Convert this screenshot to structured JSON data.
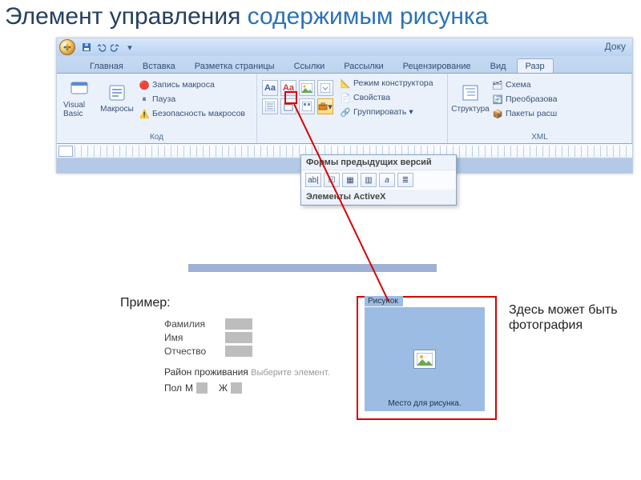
{
  "slide": {
    "title_plain": "Элемент управления ",
    "title_blue": "содержимым рисунка"
  },
  "window": {
    "doc_title": "Доку"
  },
  "tabs": {
    "home": "Главная",
    "insert": "Вставка",
    "layout": "Разметка страницы",
    "refs": "Ссылки",
    "mail": "Рассылки",
    "review": "Рецензирование",
    "view": "Вид",
    "dev": "Разр"
  },
  "ribbon": {
    "code": {
      "vb": "Visual Basic",
      "macros": "Макросы",
      "record": "Запись макроса",
      "pause": "Пауза",
      "security": "Безопасность макросов",
      "group": "Код"
    },
    "controls": {
      "aa1": "Aa",
      "aa2": "Aa",
      "design": "Режим конструктора",
      "props": "Свойства",
      "group": "Группировать"
    },
    "structure": {
      "btn": "Структура",
      "schema": "Схема",
      "transform": "Преобразова",
      "packs": "Пакеты расш",
      "group": "XML"
    }
  },
  "popup": {
    "sec1": "Формы предыдущих версий",
    "btns": [
      "ab|",
      "☑",
      "▦",
      "▥",
      "a",
      "≣"
    ],
    "sec2": "Элементы ActiveX"
  },
  "example": {
    "title": "Пример:",
    "fields": {
      "surname": "Фамилия",
      "name": "Имя",
      "patronymic": "Отчество"
    },
    "district_lbl": "Район проживания",
    "district_hint": "Выберите элемент.",
    "gender_lbl": "Пол",
    "gender_m": "М",
    "gender_f": "Ж"
  },
  "picture": {
    "tab": "Рисунок",
    "placeholder": "Место для рисунка."
  },
  "sidenote": "Здесь может быть фотография"
}
